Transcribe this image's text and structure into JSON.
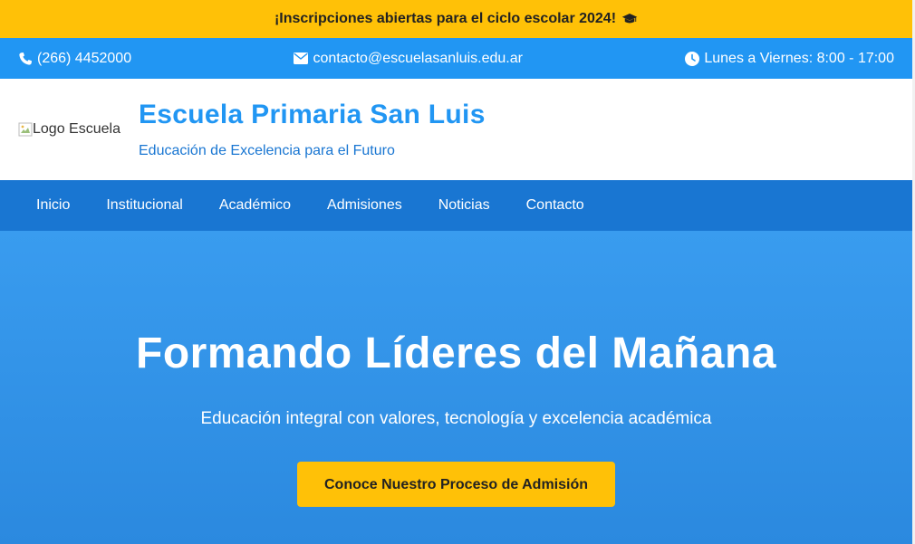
{
  "announcement": {
    "text": "¡Inscripciones abiertas para el ciclo escolar 2024!",
    "icon": "graduation-cap-icon"
  },
  "topbar": {
    "phone": "(266) 4452000",
    "email": "contacto@escuelasanluis.edu.ar",
    "hours": "Lunes a Viernes: 8:00 - 17:00"
  },
  "header": {
    "logo_alt": "Logo Escuela",
    "title": "Escuela Primaria San Luis",
    "subtitle": "Educación de Excelencia para el Futuro"
  },
  "nav": {
    "items": [
      "Inicio",
      "Institucional",
      "Académico",
      "Admisiones",
      "Noticias",
      "Contacto"
    ]
  },
  "hero": {
    "title": "Formando Líderes del Mañana",
    "subtitle": "Educación integral con valores, tecnología y excelencia académica",
    "cta_label": "Conoce Nuestro Proceso de Admisión"
  },
  "colors": {
    "accent_yellow": "#ffc107",
    "topbar_blue": "#2196f3",
    "nav_blue": "#1976d2",
    "hero_blue": "#399cef"
  }
}
